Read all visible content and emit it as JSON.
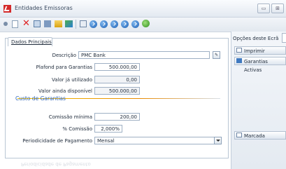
{
  "window": {
    "title": "Entidades Emissoras"
  },
  "tabs": {
    "main": "Dados Principais"
  },
  "form": {
    "descricao": {
      "label": "Descrição",
      "value": "PMC Bank"
    },
    "plafond": {
      "label": "Plafond para Garantias",
      "value": "500.000,00"
    },
    "utilizado": {
      "label": "Valor já utilizado",
      "value": "0,00"
    },
    "disponivel": {
      "label": "Valor ainda disponível",
      "value": "500.000,00"
    },
    "section": "Custo de Garantias",
    "comissao_minima": {
      "label": "Comissão mínima",
      "value": "200,00"
    },
    "pct_comissao": {
      "label": "% Comissão",
      "value": "2,000%"
    },
    "periodicidade": {
      "label": "Periodicidade de Pagamento",
      "value": "Mensal"
    }
  },
  "options": {
    "header": "Opções deste Ecrã",
    "items": [
      "Imprimir",
      "Garantias Activas",
      "Marcada"
    ]
  },
  "reflection": "Periodicidade de Pagamento"
}
